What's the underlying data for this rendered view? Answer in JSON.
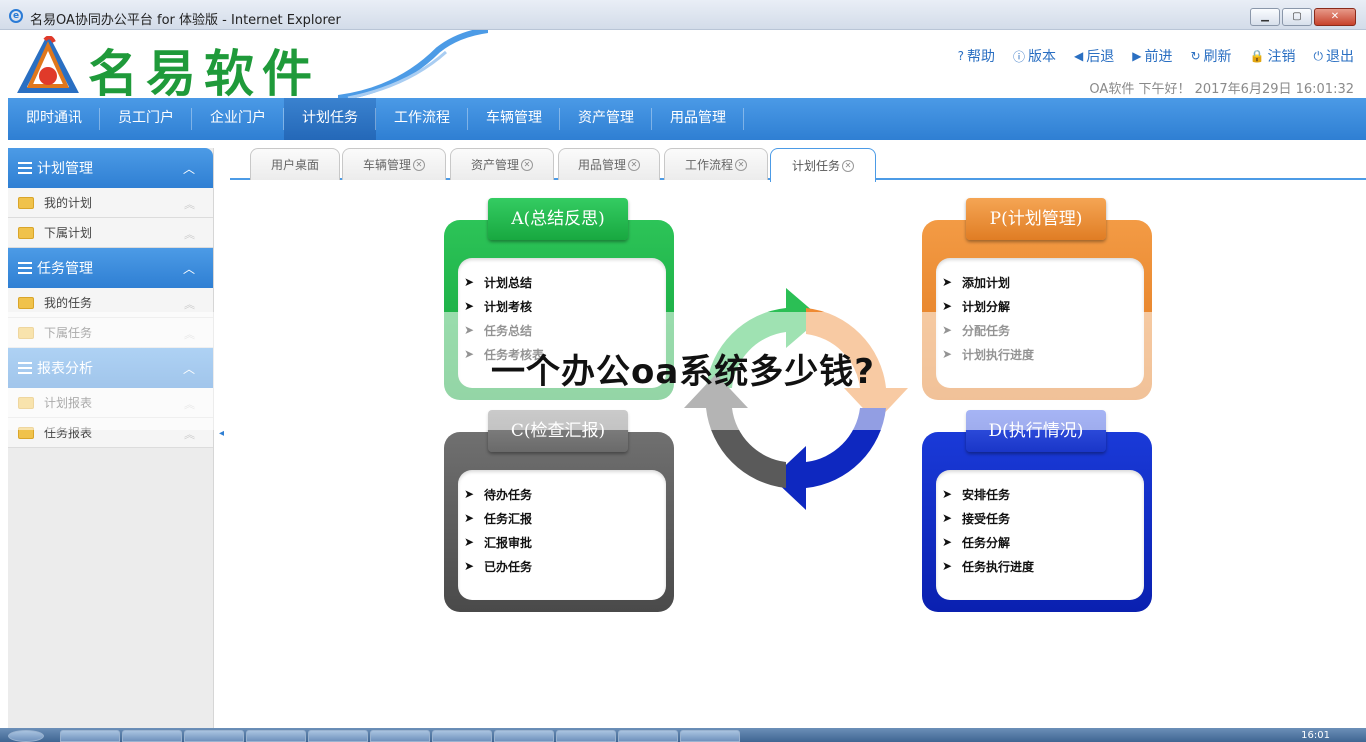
{
  "window": {
    "title": "名易OA协同办公平台 for 体验版 - Internet Explorer"
  },
  "header": {
    "logo_text": "名易软件",
    "links": [
      {
        "icon": "help-icon",
        "glyph": "?",
        "label": "帮助"
      },
      {
        "icon": "info-icon",
        "glyph": "ⓘ",
        "label": "版本"
      },
      {
        "icon": "back-icon",
        "glyph": "◀",
        "label": "后退"
      },
      {
        "icon": "forward-icon",
        "glyph": "▶",
        "label": "前进"
      },
      {
        "icon": "refresh-icon",
        "glyph": "↻",
        "label": "刷新"
      },
      {
        "icon": "lock-icon",
        "glyph": "🔒",
        "label": "注销"
      },
      {
        "icon": "power-icon",
        "glyph": "⏻",
        "label": "退出"
      }
    ],
    "greeting": "OA软件 下午好！ 2017年6月29日 16:01:32"
  },
  "nav": {
    "items": [
      "即时通讯",
      "员工门户",
      "企业门户",
      "计划任务",
      "工作流程",
      "车辆管理",
      "资产管理",
      "用品管理"
    ],
    "active": 3
  },
  "sidebar": {
    "sections": [
      {
        "title": "计划管理",
        "items": [
          "我的计划",
          "下属计划"
        ]
      },
      {
        "title": "任务管理",
        "items": [
          "我的任务",
          "下属任务"
        ]
      },
      {
        "title": "报表分析",
        "items": [
          "计划报表",
          "任务报表"
        ]
      }
    ]
  },
  "tabs": {
    "items": [
      {
        "label": "用户桌面",
        "closable": false
      },
      {
        "label": "车辆管理",
        "closable": true
      },
      {
        "label": "资产管理",
        "closable": true
      },
      {
        "label": "用品管理",
        "closable": true
      },
      {
        "label": "工作流程",
        "closable": true
      },
      {
        "label": "计划任务",
        "closable": true
      }
    ],
    "active": 5
  },
  "pdca": {
    "A": {
      "title": "A(总结反思)",
      "items": [
        "计划总结",
        "计划考核",
        "任务总结",
        "任务考核表"
      ]
    },
    "P": {
      "title": "P(计划管理)",
      "items": [
        "添加计划",
        "计划分解",
        "分配任务",
        "计划执行进度"
      ]
    },
    "C": {
      "title": "C(检查汇报)",
      "items": [
        "待办任务",
        "任务汇报",
        "汇报审批",
        "已办任务"
      ]
    },
    "D": {
      "title": "D(执行情况)",
      "items": [
        "安排任务",
        "接受任务",
        "任务分解",
        "任务执行进度"
      ]
    }
  },
  "overlay": {
    "text": "一个办公oa系统多少钱?"
  },
  "taskbar": {
    "time": "16:01"
  },
  "colors": {
    "nav_blue": "#2f7fd3",
    "green": "#11a23a",
    "orange": "#e0771c",
    "gray": "#4a4a4a",
    "blue": "#0a20b0"
  }
}
